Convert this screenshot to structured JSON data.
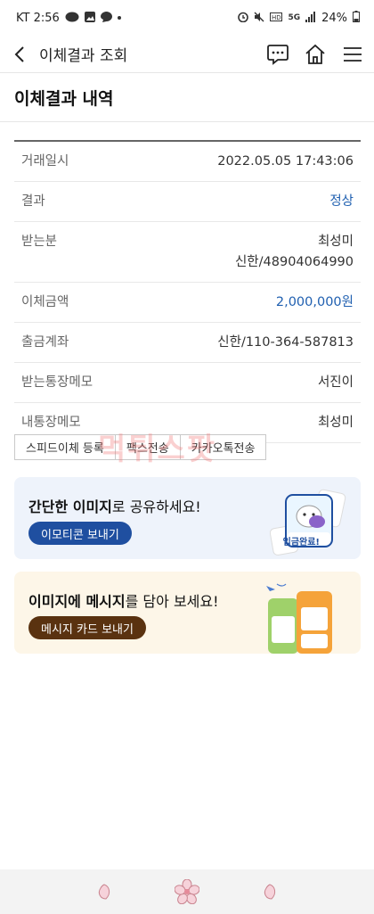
{
  "status_bar": {
    "carrier_time": "KT 2:56",
    "battery": "24%",
    "network": "5G"
  },
  "header": {
    "title": "이체결과 조회"
  },
  "page": {
    "title": "이체결과 내역"
  },
  "details": [
    {
      "label": "거래일시",
      "value": "2022.05.05 17:43:06"
    },
    {
      "label": "결과",
      "value": "정상"
    },
    {
      "label": "받는분",
      "value": "최성미",
      "value2": "신한/48904064990"
    },
    {
      "label": "이체금액",
      "value": "2,000,000원"
    },
    {
      "label": "출금계좌",
      "value": "신한/110-364-587813"
    },
    {
      "label": "받는통장메모",
      "value": "서진이"
    },
    {
      "label": "내통장메모",
      "value": "최성미"
    }
  ],
  "actions": {
    "speed_transfer": "스피드이체 등록",
    "fax": "팩스전송",
    "kakaotalk": "카카오톡전송"
  },
  "banner1": {
    "text_bold": "간단한 이미지",
    "text_rest": "로 공유하세요!",
    "button": "이모티콘 보내기",
    "badge": "입금완료!"
  },
  "banner2": {
    "text_bold1": "이미지에 메시지",
    "text_rest": "를 담아 보세요!",
    "button": "메시지 카드 보내기"
  },
  "watermark": "먹튀스팟",
  "colors": {
    "accent_blue": "#1f5fb0",
    "banner1_bg": "#eef3fb",
    "banner2_bg": "#fdf6e8"
  }
}
